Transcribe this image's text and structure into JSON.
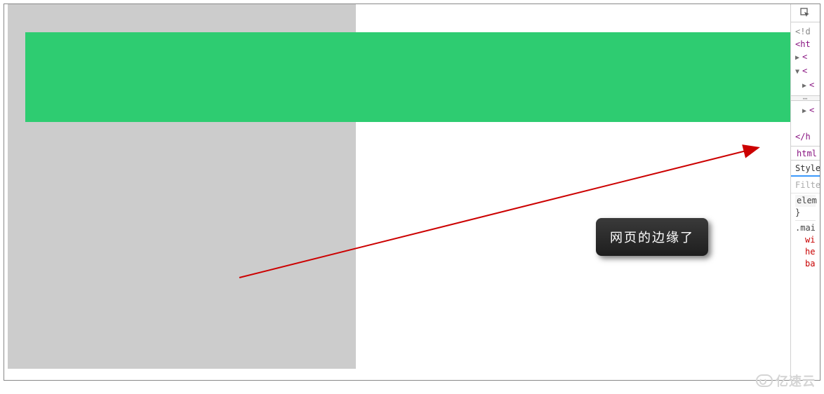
{
  "annotation": {
    "text": "网页的边缘了"
  },
  "colors": {
    "green_bar": "#2ecc71",
    "gray_region": "#cccccc",
    "arrow": "#cc0000"
  },
  "devtools": {
    "dom": {
      "doctype_fragment": "<!d",
      "html_open_fragment": "<ht",
      "child_fragment_1": "<",
      "child_fragment_2": "<",
      "child_fragment_3": "<",
      "child_fragment_4": "<",
      "html_close_fragment": "</h"
    },
    "separator": "⋯",
    "breadcrumb": "html",
    "tabs": {
      "styles": "Style"
    },
    "filter_placeholder": "Filter",
    "styles": {
      "element_selector": "elem",
      "element_close": "}",
      "main_selector": ".mai",
      "prop1": "wi",
      "prop2": "he",
      "prop3": "ba"
    }
  },
  "watermark": {
    "text": "亿速云"
  }
}
